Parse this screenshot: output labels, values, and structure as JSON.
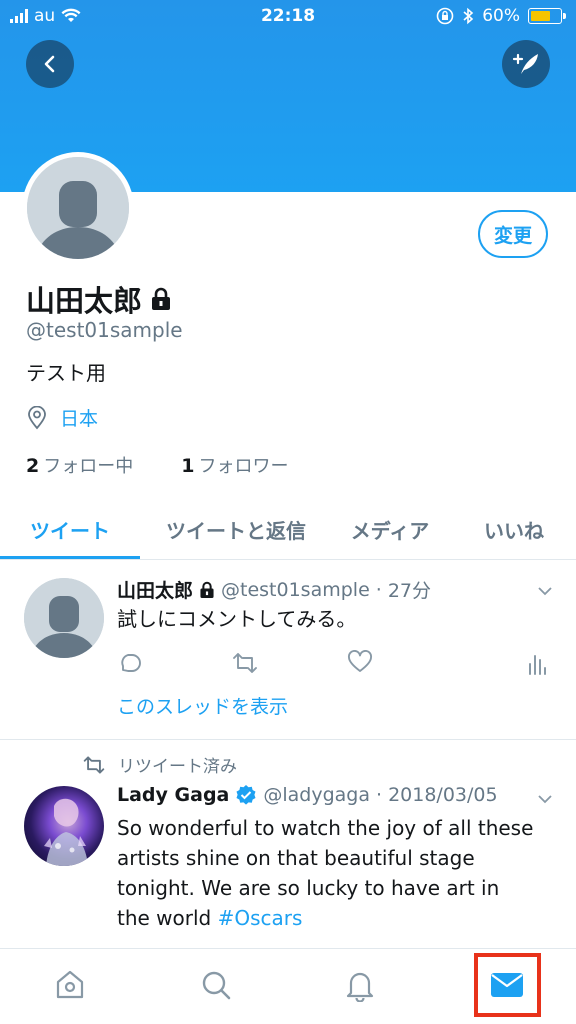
{
  "status_bar": {
    "carrier": "au",
    "time": "22:18",
    "battery": "60%"
  },
  "profile": {
    "name": "山田太郎",
    "handle": "@test01sample",
    "bio": "テスト用",
    "location": "日本",
    "following_count": "2",
    "following_label": "フォロー中",
    "followers_count": "1",
    "followers_label": "フォロワー",
    "edit_label": "変更"
  },
  "tabs": [
    {
      "label": "ツイート",
      "active": true
    },
    {
      "label": "ツイートと返信",
      "active": false
    },
    {
      "label": "メディア",
      "active": false
    },
    {
      "label": "いいね",
      "active": false
    }
  ],
  "tweets": [
    {
      "name": "山田太郎",
      "handle": "@test01sample",
      "time": "27分",
      "text": "試しにコメントしてみる。",
      "thread_link": "このスレッドを表示"
    },
    {
      "retweet_label": "リツイート済み",
      "name": "Lady Gaga",
      "handle": "@ladygaga",
      "time": "2018/03/05",
      "text": "So wonderful to watch the joy of all these artists shine on that beautiful stage tonight. We are so lucky to have art in the world ",
      "hashtag": "#Oscars"
    }
  ],
  "icons": {
    "back": "chevron-left-icon",
    "compose": "compose-icon",
    "lock": "lock-icon",
    "location": "location-pin-icon",
    "nav": [
      "home-icon",
      "search-icon",
      "bell-icon",
      "mail-icon"
    ]
  },
  "colors": {
    "accent": "#1da1f2",
    "highlight": "#e8321a",
    "muted": "#657786"
  }
}
